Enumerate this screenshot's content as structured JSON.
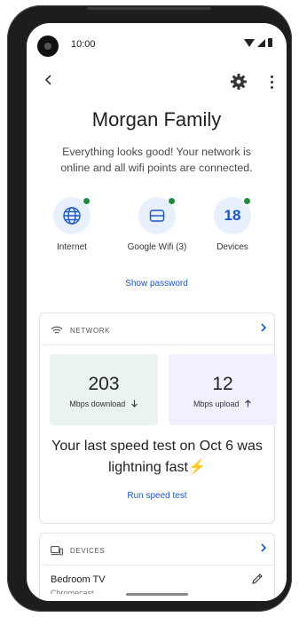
{
  "status_bar": {
    "time": "10:00"
  },
  "header": {
    "title": "Morgan Family",
    "subtitle": "Everything looks good! Your network is online and all wifi points are connected."
  },
  "summary_tiles": [
    {
      "label": "Internet",
      "icon": "globe-icon"
    },
    {
      "label": "Google Wifi (3)",
      "icon": "wifi-point-icon"
    },
    {
      "label": "Devices",
      "count": "18"
    }
  ],
  "show_password_label": "Show password",
  "network_card": {
    "heading": "NETWORK",
    "download": {
      "value": "203",
      "label": "Mbps download"
    },
    "upload": {
      "value": "12",
      "label": "Mbps upload"
    },
    "message": "Your last speed test on Oct 6 was lightning fast",
    "run_label": "Run speed test"
  },
  "devices_card": {
    "heading": "DEVICES",
    "first_device": {
      "name": "Bedroom TV",
      "type": "Chromecast"
    }
  },
  "colors": {
    "accent": "#1a56c4",
    "online": "#1e8e3e",
    "download_bg": "#eaf4ee",
    "upload_bg": "#f3efff"
  }
}
